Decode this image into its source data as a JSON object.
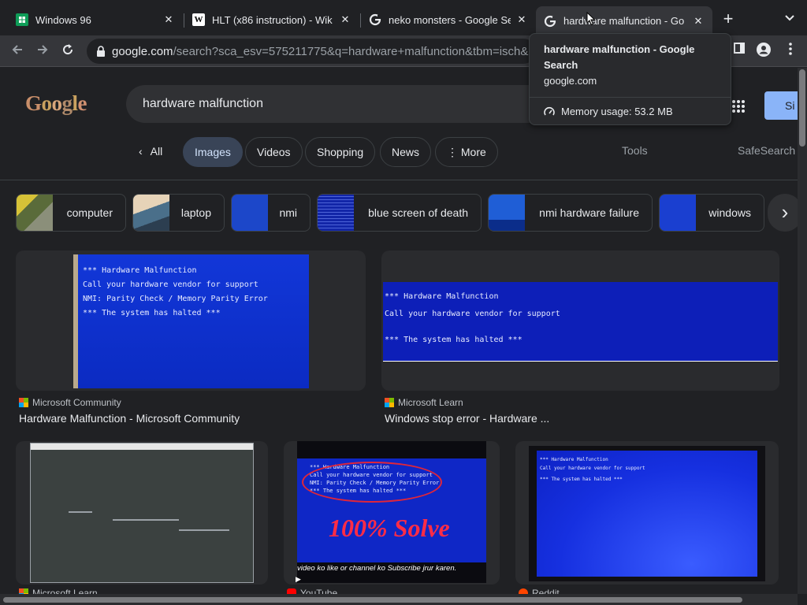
{
  "tabs": [
    {
      "title": "Windows 96",
      "favicon": "sheets-icon",
      "active": false
    },
    {
      "title": "HLT (x86 instruction) - Wik",
      "favicon": "wikipedia-icon",
      "active": false
    },
    {
      "title": "neko monsters - Google Se",
      "favicon": "google-icon",
      "active": false
    },
    {
      "title": "hardware malfunction - Go",
      "favicon": "google-icon",
      "active": true
    }
  ],
  "omnibox": {
    "host": "google.com",
    "path": "/search?sca_esv=575211775&q=hardware+malfunction&tbm=isch&s"
  },
  "hovercard": {
    "title": "hardware malfunction - Google Search",
    "domain": "google.com",
    "memory": "Memory usage: 53.2 MB"
  },
  "search": {
    "query": "hardware malfunction",
    "signin_label": "Si"
  },
  "filters": {
    "back_all": "All",
    "items": [
      "Images",
      "Videos",
      "Shopping",
      "News",
      "More"
    ],
    "tools": "Tools",
    "safesearch": "SafeSearch"
  },
  "related": [
    "computer",
    "laptop",
    "nmi",
    "blue screen of death",
    "nmi hardware failure",
    "windows"
  ],
  "bsod_lines": {
    "a": [
      "*** Hardware Malfunction",
      "Call your hardware vendor for support",
      "NMI: Parity Check / Memory Parity Error",
      "*** The system has halted ***"
    ],
    "b": [
      "*** Hardware Malfunction",
      "Call your hardware vendor for support",
      "",
      "*** The system has halted ***"
    ],
    "d_overlay": "100% Solve",
    "d_caption": "video ko like or channel ko Subscribe jrur karen."
  },
  "results": [
    {
      "source": "Microsoft Community",
      "title": "Hardware Malfunction - Microsoft Community"
    },
    {
      "source": "Microsoft Learn",
      "title": "Windows stop error - Hardware ..."
    },
    {
      "source": "Microsoft Learn",
      "title": ""
    },
    {
      "source": "YouTube",
      "title": ""
    },
    {
      "source": "Reddit",
      "title": ""
    }
  ],
  "colors": {
    "bsod_blue": "#0b22c9",
    "accent": "#8ab4f8",
    "selected_chip": "#394457"
  }
}
